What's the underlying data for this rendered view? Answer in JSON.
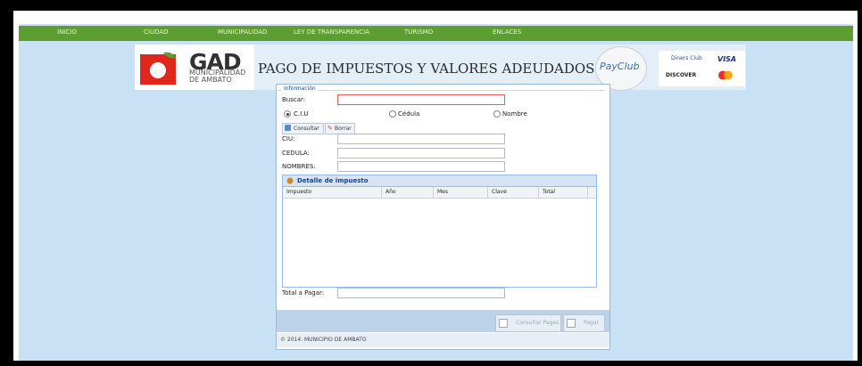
{
  "nav": [
    "INICIO",
    "CIUDAD",
    "MUNICIPALIDAD",
    "LEY DE TRANSPARENCIA",
    "TURISMO",
    "ENLACES"
  ],
  "logo": {
    "gad": "GAD",
    "muni_line1": "MUNICIPALIDAD",
    "muni_line2": "DE AMBATO"
  },
  "header_title": "PAGO DE IMPUESTOS Y VALORES ADEUDADOS",
  "payclub": "PayClub",
  "cards": {
    "diners": "Diners Club",
    "visa": "VISA",
    "discover": "DISCOVER"
  },
  "form": {
    "legend": "Información",
    "buscar_label": "Buscar:",
    "buscar_value": "",
    "radios": [
      {
        "label": "C.I.U",
        "selected": true
      },
      {
        "label": "Cédula",
        "selected": false
      },
      {
        "label": "Nombre",
        "selected": false
      }
    ],
    "consultar": "Consultar",
    "borrar": "Borrar",
    "ciu_label": "CIU:",
    "cedula_label": "CEDULA:",
    "nombres_label": "NOMBRES:",
    "total_label": "Total a Pagar:"
  },
  "grid": {
    "title": "Detalle de impuesto",
    "columns": [
      "Impuesto",
      "Año",
      "Mes",
      "Clave",
      "Total"
    ],
    "rows": []
  },
  "actions": {
    "consultar_pagos": "Consultar Pagos",
    "pagar": "Pagar"
  },
  "footer": "© 2014. MUNICIPIO DE AMBATO",
  "colors": {
    "nav": "#5c9e2f",
    "background": "#c9e1f5",
    "grid_header": "#d5e3f5"
  }
}
